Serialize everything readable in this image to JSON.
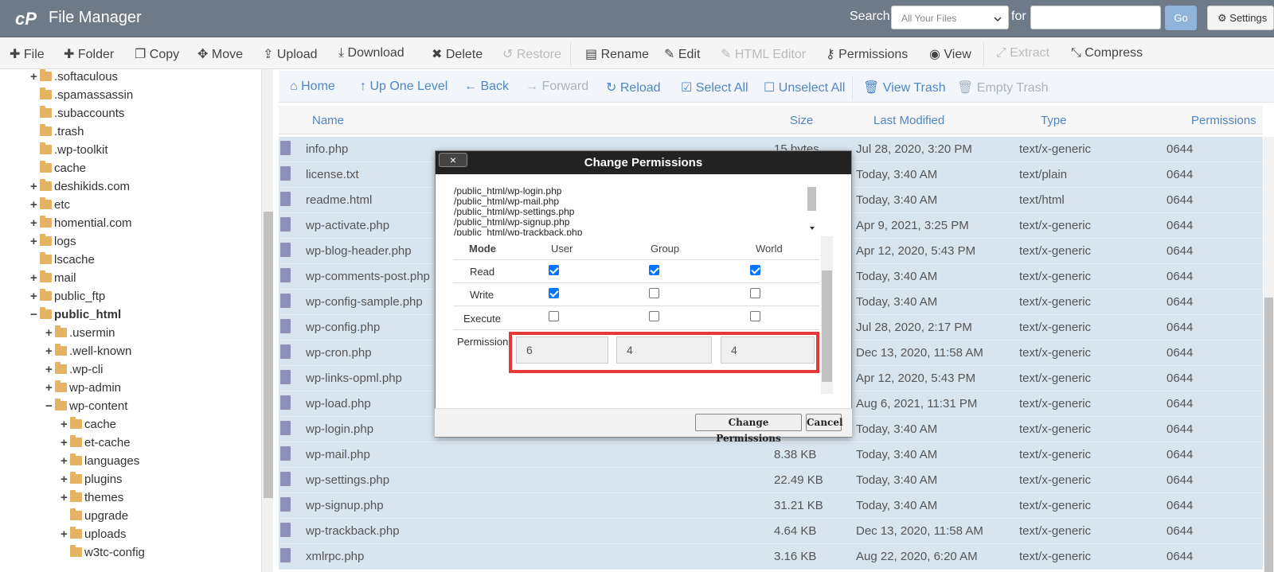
{
  "header": {
    "title": "File Manager",
    "search_label": "Search",
    "search_scope": "All Your Files",
    "for_label": "for",
    "search_value": "",
    "go_label": "Go",
    "settings_label": "Settings"
  },
  "toolbar": {
    "file": "File",
    "folder": "Folder",
    "copy": "Copy",
    "move": "Move",
    "upload": "Upload",
    "download": "Download",
    "delete": "Delete",
    "restore": "Restore",
    "rename": "Rename",
    "edit": "Edit",
    "html_editor": "HTML Editor",
    "permissions": "Permissions",
    "view": "View",
    "extract": "Extract",
    "compress": "Compress"
  },
  "tree": [
    {
      "label": ".softaculous",
      "toggle": "+"
    },
    {
      "label": ".spamassassin",
      "toggle": ""
    },
    {
      "label": ".subaccounts",
      "toggle": ""
    },
    {
      "label": ".trash",
      "toggle": ""
    },
    {
      "label": ".wp-toolkit",
      "toggle": ""
    },
    {
      "label": "cache",
      "toggle": ""
    },
    {
      "label": "deshikids.com",
      "toggle": "+"
    },
    {
      "label": "etc",
      "toggle": "+"
    },
    {
      "label": "homential.com",
      "toggle": "+"
    },
    {
      "label": "logs",
      "toggle": "+"
    },
    {
      "label": "lscache",
      "toggle": ""
    },
    {
      "label": "mail",
      "toggle": "+"
    },
    {
      "label": "public_ftp",
      "toggle": "+"
    },
    {
      "label": "public_html",
      "toggle": "−"
    },
    {
      "label": ".usermin",
      "toggle": "+"
    },
    {
      "label": ".well-known",
      "toggle": "+"
    },
    {
      "label": ".wp-cli",
      "toggle": "+"
    },
    {
      "label": "wp-admin",
      "toggle": "+"
    },
    {
      "label": "wp-content",
      "toggle": "−"
    },
    {
      "label": "cache",
      "toggle": "+"
    },
    {
      "label": "et-cache",
      "toggle": "+"
    },
    {
      "label": "languages",
      "toggle": "+"
    },
    {
      "label": "plugins",
      "toggle": "+"
    },
    {
      "label": "themes",
      "toggle": "+"
    },
    {
      "label": "upgrade",
      "toggle": ""
    },
    {
      "label": "uploads",
      "toggle": "+"
    },
    {
      "label": "w3tc-config",
      "toggle": ""
    }
  ],
  "nav": {
    "home": "Home",
    "up": "Up One Level",
    "back": "Back",
    "forward": "Forward",
    "reload": "Reload",
    "select_all": "Select All",
    "unselect_all": "Unselect All",
    "view_trash": "View Trash",
    "empty_trash": "Empty Trash"
  },
  "columns": {
    "name": "Name",
    "size": "Size",
    "modified": "Last Modified",
    "type": "Type",
    "perms": "Permissions"
  },
  "files": [
    {
      "name": "info.php",
      "size": "15 bytes",
      "modified": "Jul 28, 2020, 3:20 PM",
      "type": "text/x-generic",
      "perms": "0644"
    },
    {
      "name": "license.txt",
      "size": "",
      "modified": "Today, 3:40 AM",
      "type": "text/plain",
      "perms": "0644"
    },
    {
      "name": "readme.html",
      "size": "",
      "modified": "Today, 3:40 AM",
      "type": "text/html",
      "perms": "0644"
    },
    {
      "name": "wp-activate.php",
      "size": "",
      "modified": "Apr 9, 2021, 3:25 PM",
      "type": "text/x-generic",
      "perms": "0644"
    },
    {
      "name": "wp-blog-header.php",
      "size": "",
      "modified": "Apr 12, 2020, 5:43 PM",
      "type": "text/x-generic",
      "perms": "0644"
    },
    {
      "name": "wp-comments-post.php",
      "size": "",
      "modified": "Today, 3:40 AM",
      "type": "text/x-generic",
      "perms": "0644"
    },
    {
      "name": "wp-config-sample.php",
      "size": "",
      "modified": "Today, 3:40 AM",
      "type": "text/x-generic",
      "perms": "0644"
    },
    {
      "name": "wp-config.php",
      "size": "",
      "modified": "Jul 28, 2020, 2:17 PM",
      "type": "text/x-generic",
      "perms": "0644"
    },
    {
      "name": "wp-cron.php",
      "size": "",
      "modified": "Dec 13, 2020, 11:58 AM",
      "type": "text/x-generic",
      "perms": "0644"
    },
    {
      "name": "wp-links-opml.php",
      "size": "",
      "modified": "Apr 12, 2020, 5:43 PM",
      "type": "text/x-generic",
      "perms": "0644"
    },
    {
      "name": "wp-load.php",
      "size": "",
      "modified": "Aug 6, 2021, 11:31 PM",
      "type": "text/x-generic",
      "perms": "0644"
    },
    {
      "name": "wp-login.php",
      "size": "",
      "modified": "Today, 3:40 AM",
      "type": "text/x-generic",
      "perms": "0644"
    },
    {
      "name": "wp-mail.php",
      "size": "8.38 KB",
      "modified": "Today, 3:40 AM",
      "type": "text/x-generic",
      "perms": "0644"
    },
    {
      "name": "wp-settings.php",
      "size": "22.49 KB",
      "modified": "Today, 3:40 AM",
      "type": "text/x-generic",
      "perms": "0644"
    },
    {
      "name": "wp-signup.php",
      "size": "31.21 KB",
      "modified": "Today, 3:40 AM",
      "type": "text/x-generic",
      "perms": "0644"
    },
    {
      "name": "wp-trackback.php",
      "size": "4.64 KB",
      "modified": "Dec 13, 2020, 11:58 AM",
      "type": "text/x-generic",
      "perms": "0644"
    },
    {
      "name": "xmlrpc.php",
      "size": "3.16 KB",
      "modified": "Aug 22, 2020, 6:20 AM",
      "type": "text/x-generic",
      "perms": "0644"
    }
  ],
  "modal": {
    "title": "Change Permissions",
    "close": "×",
    "paths": [
      "/public_html/wp-login.php",
      "/public_html/wp-mail.php",
      "/public_html/wp-settings.php",
      "/public_html/wp-signup.php",
      "/public_html/wp-trackback.php"
    ],
    "mode_label": "Mode",
    "user_label": "User",
    "group_label": "Group",
    "world_label": "World",
    "read_label": "Read",
    "write_label": "Write",
    "execute_label": "Execute",
    "permission_label": "Permission",
    "checks": {
      "read": [
        true,
        true,
        true
      ],
      "write": [
        true,
        false,
        false
      ],
      "execute": [
        false,
        false,
        false
      ]
    },
    "octal_user": "6",
    "octal_group": "4",
    "octal_world": "4",
    "confirm_label": "Change Permissions",
    "cancel_label": "Cancel"
  },
  "colors": {
    "header": "#6e7a88",
    "link": "#4f86c6",
    "row_selected": "#d8e4ee",
    "highlight": "#e53935"
  }
}
